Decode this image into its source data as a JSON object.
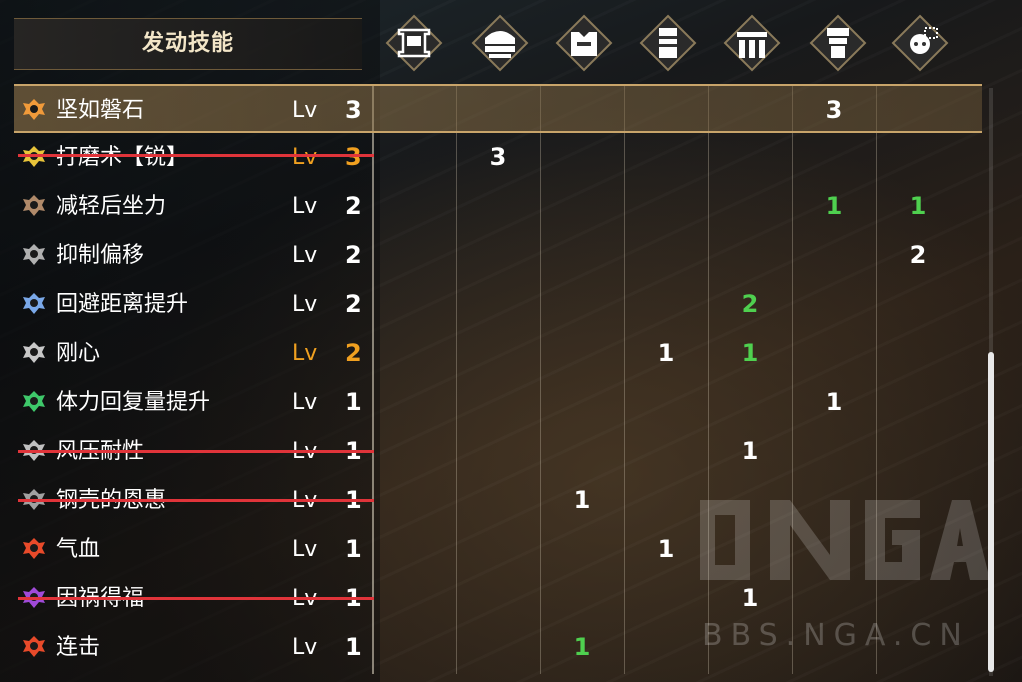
{
  "header": {
    "title": "发动技能"
  },
  "columns": [
    {
      "icon": "weapon-slot-icon"
    },
    {
      "icon": "helm-icon"
    },
    {
      "icon": "chest-icon"
    },
    {
      "icon": "arm-icon"
    },
    {
      "icon": "waist-icon"
    },
    {
      "icon": "leg-icon"
    },
    {
      "icon": "talisman-icon"
    }
  ],
  "lv_label": "Lv",
  "skills": [
    {
      "name": "坚如磐石",
      "level": "3",
      "color": "#f09a3a",
      "cells": [
        "",
        "",
        "",
        "",
        "",
        "3",
        ""
      ],
      "selected": true
    },
    {
      "name": "打磨术【锐】",
      "level": "3",
      "color": "#e8c43a",
      "cells": [
        "",
        "3",
        "",
        "",
        "",
        "",
        ""
      ],
      "struck": true,
      "level_orange": true
    },
    {
      "name": "减轻后坐力",
      "level": "2",
      "color": "#b08a6a",
      "cells": [
        "",
        "",
        "",
        "",
        "",
        "1",
        "1"
      ]
    },
    {
      "name": "抑制偏移",
      "level": "2",
      "color": "#b0b0b0",
      "cells": [
        "",
        "",
        "",
        "",
        "",
        "",
        "2"
      ]
    },
    {
      "name": "回避距离提升",
      "level": "2",
      "color": "#7aa8e8",
      "cells": [
        "",
        "",
        "",
        "",
        "2",
        "",
        ""
      ]
    },
    {
      "name": "刚心",
      "level": "2",
      "color": "#c8c8c8",
      "cells": [
        "",
        "",
        "",
        "1",
        "1",
        "",
        ""
      ],
      "level_orange": true
    },
    {
      "name": "体力回复量提升",
      "level": "1",
      "color": "#3ec86a",
      "cells": [
        "",
        "",
        "",
        "",
        "",
        "1",
        ""
      ]
    },
    {
      "name": "风压耐性",
      "level": "1",
      "color": "#c0c0c0",
      "cells": [
        "",
        "",
        "",
        "",
        "1",
        "",
        ""
      ],
      "struck": true
    },
    {
      "name": "钢壳的恩惠",
      "level": "1",
      "color": "#a0a0a0",
      "cells": [
        "",
        "",
        "1",
        "",
        "",
        "",
        ""
      ],
      "struck": true
    },
    {
      "name": "气血",
      "level": "1",
      "color": "#e84a2a",
      "cells": [
        "",
        "",
        "",
        "1",
        "",
        "",
        ""
      ]
    },
    {
      "name": "因祸得福",
      "level": "1",
      "color": "#a04ad8",
      "cells": [
        "",
        "",
        "",
        "",
        "1",
        "",
        ""
      ],
      "struck": true
    },
    {
      "name": "连击",
      "level": "1",
      "color": "#e84a2a",
      "cells": [
        "",
        "",
        "1",
        "",
        "",
        "",
        ""
      ]
    }
  ],
  "green_cells": [
    [
      2,
      5
    ],
    [
      2,
      6
    ],
    [
      4,
      4
    ],
    [
      5,
      4
    ],
    [
      11,
      2
    ]
  ],
  "watermark": {
    "logo": "NGA",
    "text": "BBS.NGA.CN"
  }
}
